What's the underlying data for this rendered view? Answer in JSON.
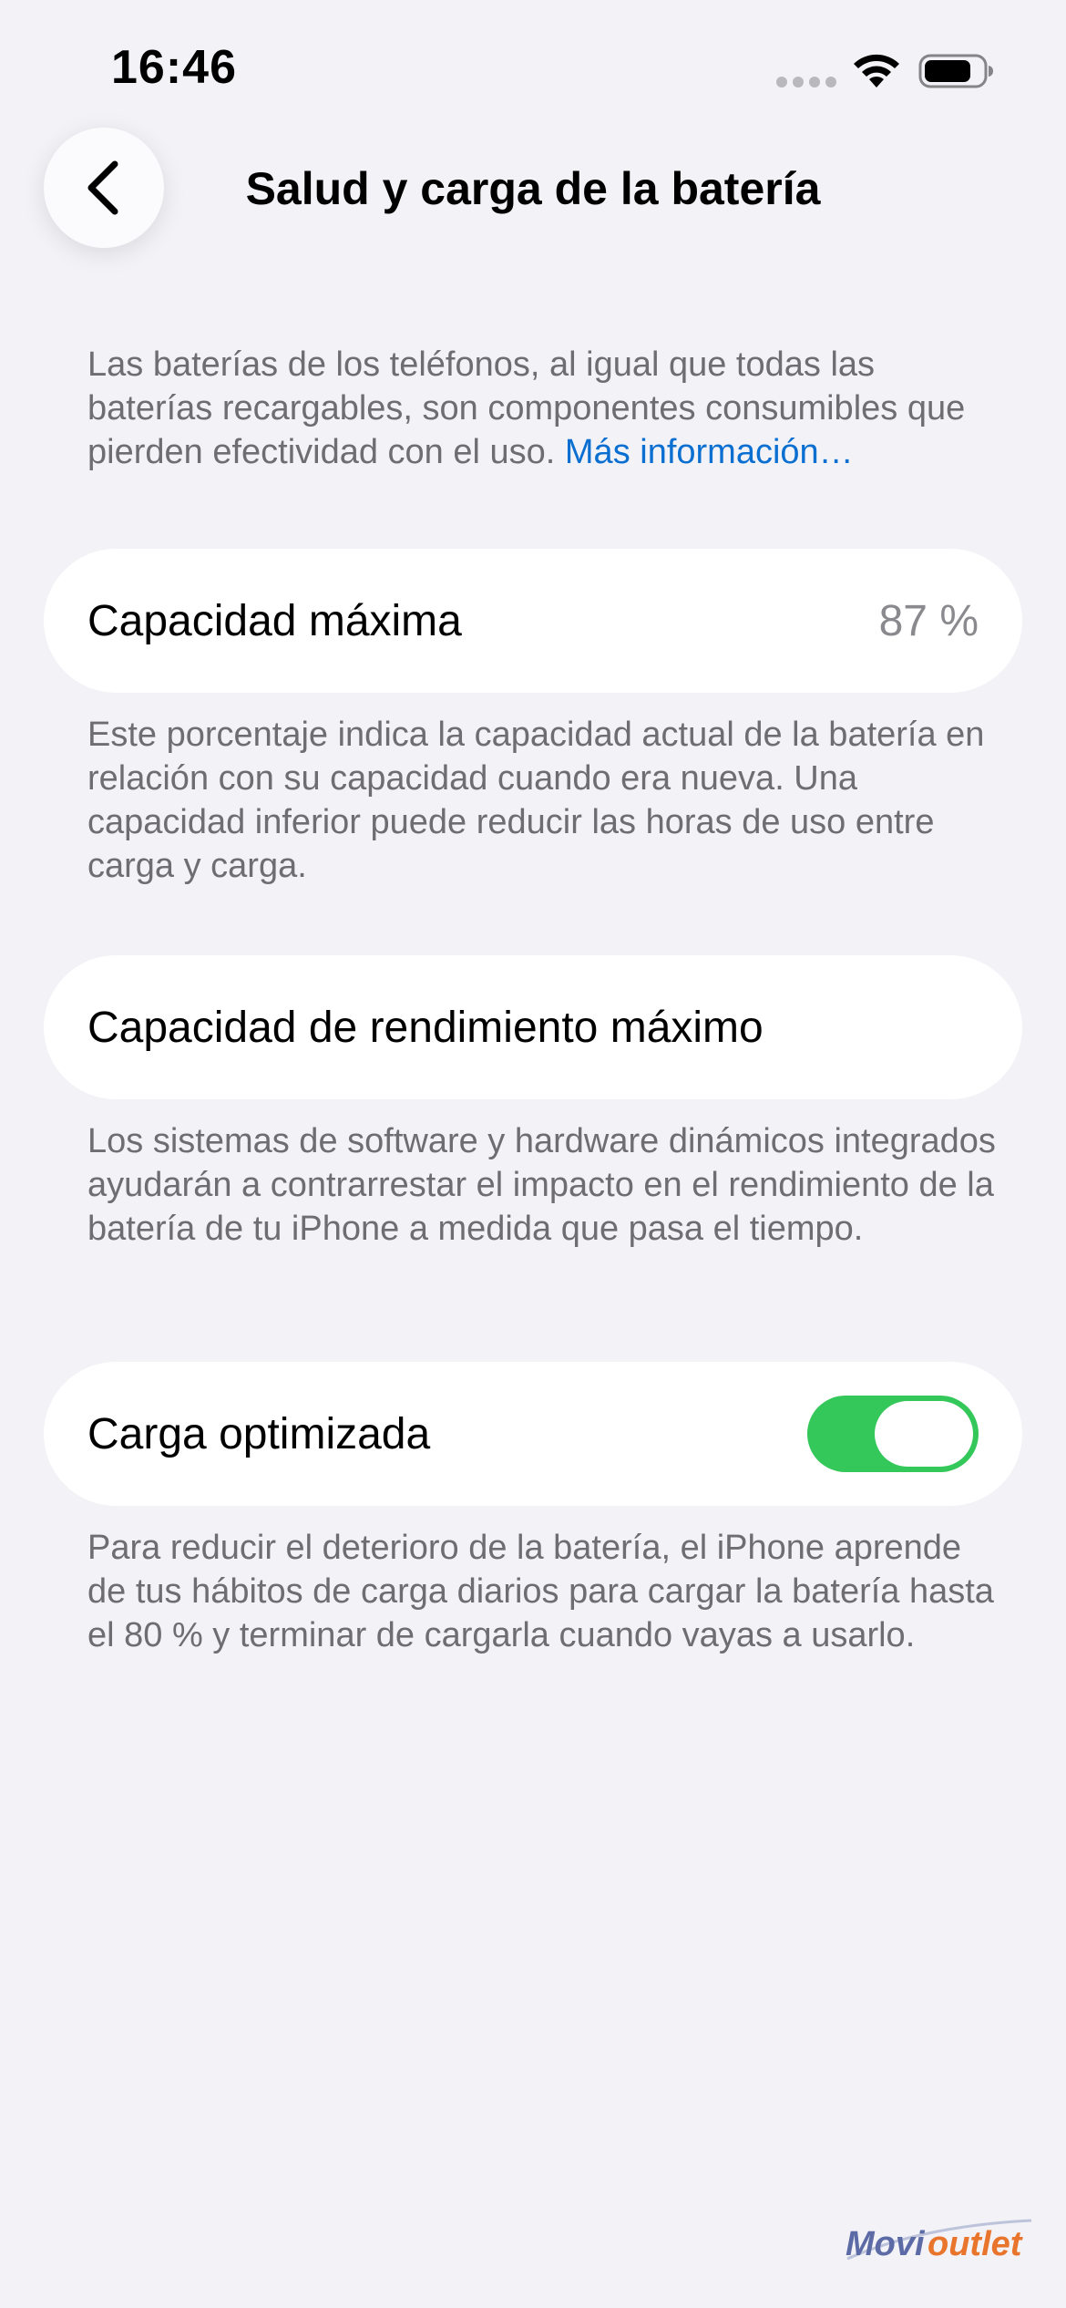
{
  "status_bar": {
    "time": "16:46",
    "icons": [
      "signal-dots-icon",
      "wifi-icon",
      "battery-icon"
    ]
  },
  "nav": {
    "back_icon": "chevron-left-icon",
    "title": "Salud y carga de la batería"
  },
  "intro": {
    "text": "Las baterías de los teléfonos, al igual que todas las baterías recargables, son componentes consumibles que pierden efectividad con el uso.",
    "link": "Más información…"
  },
  "max_capacity": {
    "label": "Capacidad máxima",
    "value": "87 %",
    "footnote": "Este porcentaje indica la capacidad actual de la batería en relación con su capacidad cuando era nueva. Una capacidad inferior puede reducir las horas de uso entre carga y carga."
  },
  "peak_performance": {
    "label": "Capacidad de rendimiento máximo",
    "footnote": "Los sistemas de software y hardware dinámicos integrados ayudarán a contrarrestar el impacto en el rendimiento de la batería de tu iPhone a medida que pasa el tiempo."
  },
  "optimized_charging": {
    "label": "Carga optimizada",
    "enabled": true,
    "toggle_color": "#34c759",
    "footnote": "Para reducir el deterioro de la batería, el iPhone aprende de tus hábitos de carga diarios para cargar la batería hasta el 80 % y terminar de cargarla cuando vayas a usarlo."
  },
  "colors": {
    "background": "#f2f2f7",
    "link": "#0a6fd1",
    "secondary_text": "#6d6d72"
  },
  "watermark": {
    "brand_part1": "Movi",
    "brand_part2": "outlet"
  }
}
